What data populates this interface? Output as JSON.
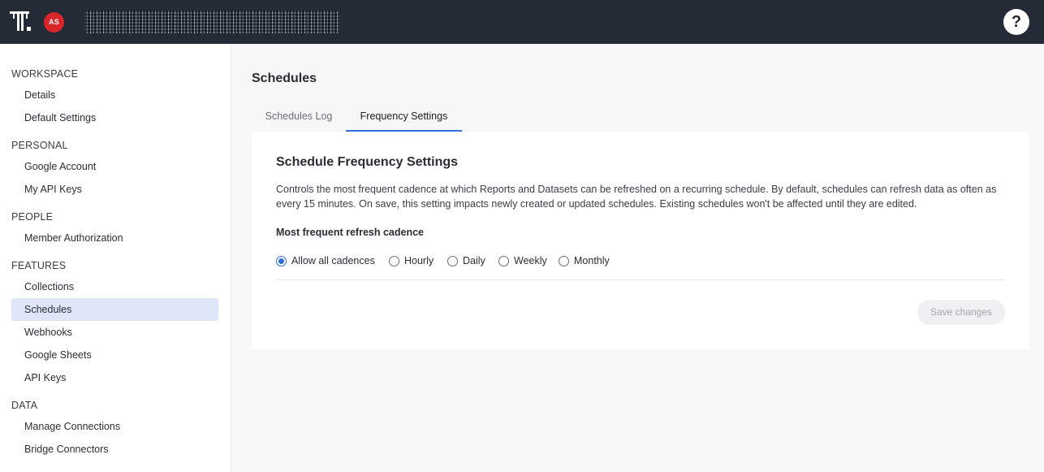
{
  "topbar": {
    "logo_icon": "tabular-logo-icon",
    "avatar_initials": "AS",
    "workspace_name": "",
    "help_label": "?"
  },
  "sidebar": {
    "sections": [
      {
        "title": "WORKSPACE",
        "items": [
          "Details",
          "Default Settings"
        ]
      },
      {
        "title": "PERSONAL",
        "items": [
          "Google Account",
          "My API Keys"
        ]
      },
      {
        "title": "PEOPLE",
        "items": [
          "Member Authorization"
        ]
      },
      {
        "title": "FEATURES",
        "items": [
          "Collections",
          "Schedules",
          "Webhooks",
          "Google Sheets",
          "API Keys"
        ]
      },
      {
        "title": "DATA",
        "items": [
          "Manage Connections",
          "Bridge Connectors"
        ]
      }
    ],
    "active_item": "Schedules"
  },
  "main": {
    "title": "Schedules",
    "tabs": [
      {
        "label": "Schedules Log",
        "active": false
      },
      {
        "label": "Frequency Settings",
        "active": true
      }
    ]
  },
  "card": {
    "title": "Schedule Frequency Settings",
    "description": "Controls the most frequent cadence at which Reports and Datasets can be refreshed on a recurring schedule. By default, schedules can refresh data as often as every 15 minutes. On save, this setting impacts newly created or updated schedules. Existing schedules won't be affected until they are edited.",
    "field_label": "Most frequent refresh cadence",
    "options": [
      {
        "label": "Allow all cadences",
        "checked": true
      },
      {
        "label": "Hourly",
        "checked": false
      },
      {
        "label": "Daily",
        "checked": false
      },
      {
        "label": "Weekly",
        "checked": false
      },
      {
        "label": "Monthly",
        "checked": false
      }
    ],
    "save_label": "Save changes"
  },
  "colors": {
    "topbar": "#242a36",
    "accent": "#2f6fd6",
    "avatar": "#d9262a",
    "active_sidebar": "#dfe6f7"
  }
}
